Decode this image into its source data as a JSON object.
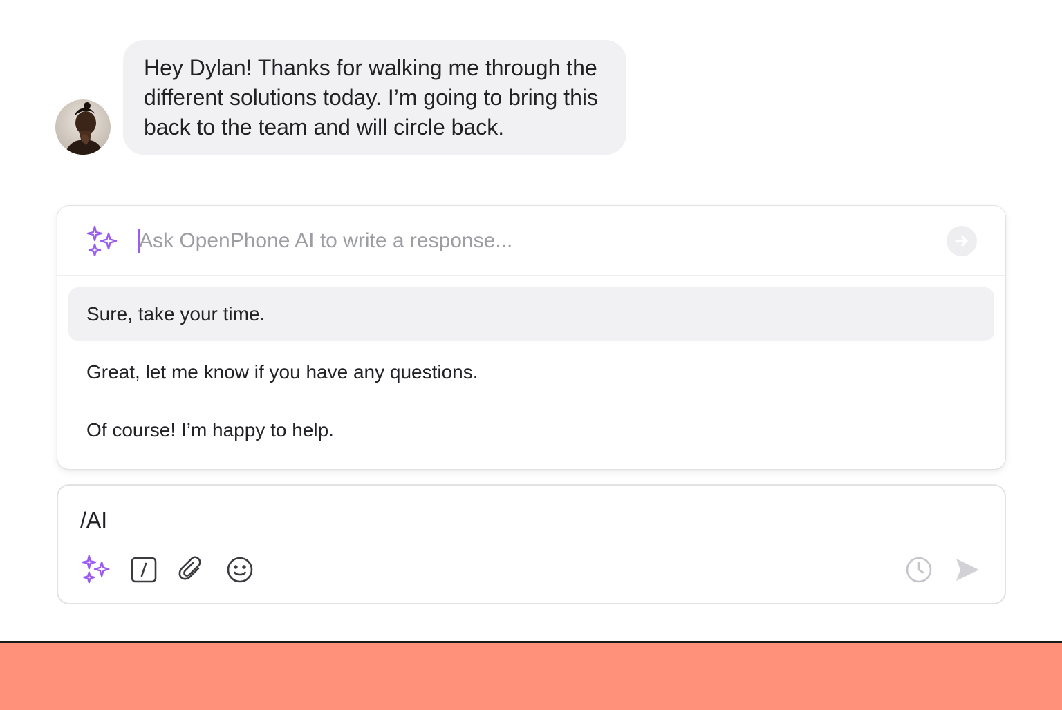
{
  "conversation": {
    "incoming_message": "Hey Dylan! Thanks for walking me through the\ndifferent solutions today. I’m going to bring this\nback to the team and will circle back.",
    "avatar_icon": "person-avatar"
  },
  "ai_assistant": {
    "sparkle_icon": "sparkle-icon",
    "placeholder": "Ask OpenPhone AI to write a response...",
    "submit_icon": "arrow-right-circle-icon",
    "suggestions": [
      "Sure, take your time.",
      "Great, let me know if you have any questions.",
      "Of course! I’m happy to help."
    ],
    "selected_index": 0
  },
  "composer": {
    "text": "/AI",
    "tools": [
      "sparkle-icon",
      "slash-command-icon",
      "paperclip-icon",
      "emoji-icon"
    ],
    "right_tools": [
      "clock-icon",
      "send-icon"
    ]
  },
  "colors": {
    "accent": "#9a5cf0",
    "bubble": "#f1f1f4",
    "footer": "#ff907a"
  }
}
